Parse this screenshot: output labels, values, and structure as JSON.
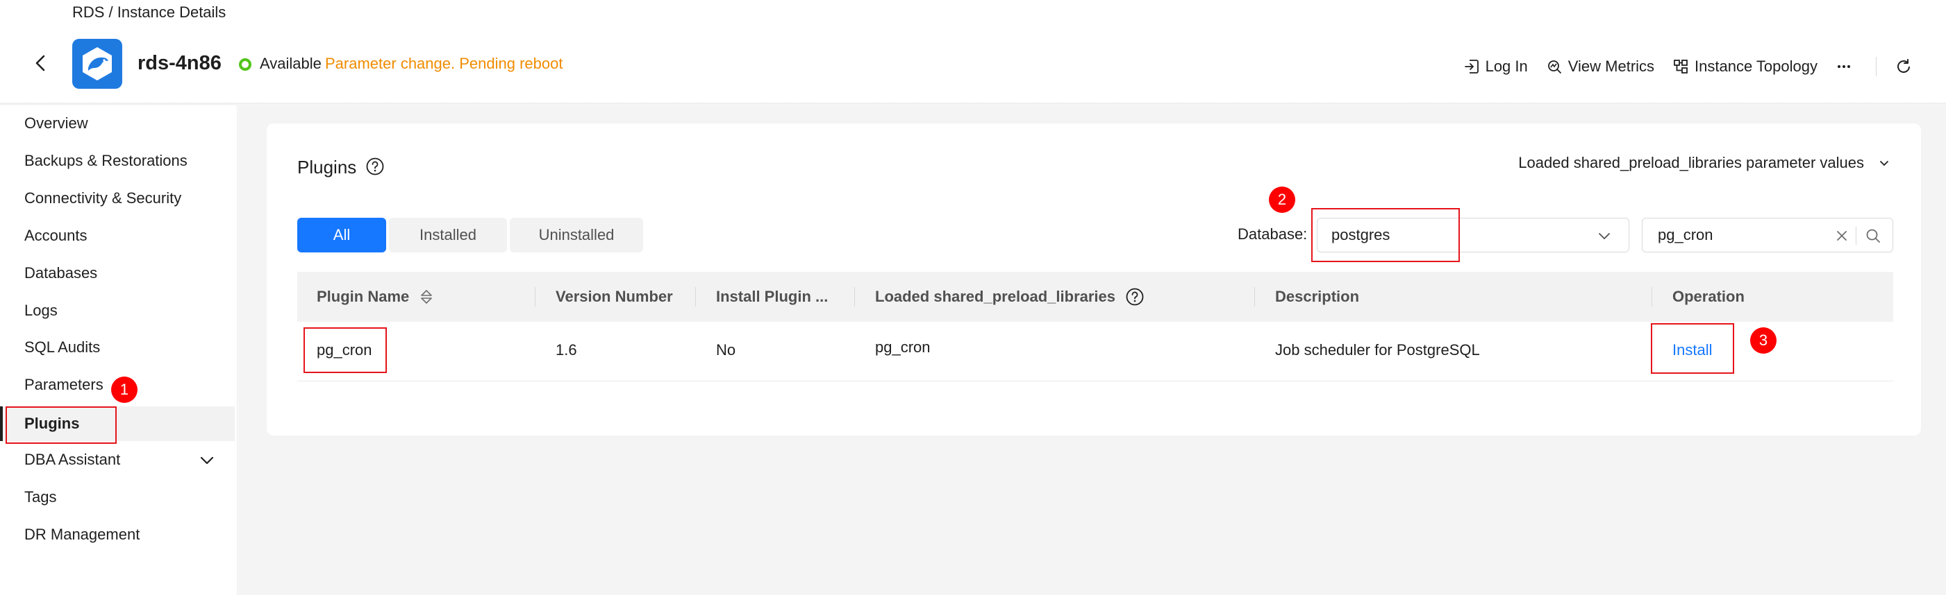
{
  "header": {
    "breadcrumb": "RDS / Instance Details",
    "instance_name": "rds-4n86",
    "status": "Available",
    "status_warning": "Parameter change. Pending reboot",
    "actions": {
      "login": "Log In",
      "metrics": "View Metrics",
      "topology": "Instance Topology"
    }
  },
  "sidebar": {
    "items": [
      {
        "label": "Overview"
      },
      {
        "label": "Backups & Restorations"
      },
      {
        "label": "Connectivity & Security"
      },
      {
        "label": "Accounts"
      },
      {
        "label": "Databases"
      },
      {
        "label": "Logs"
      },
      {
        "label": "SQL Audits"
      },
      {
        "label": "Parameters"
      },
      {
        "label": "Plugins"
      },
      {
        "label": "DBA Assistant"
      },
      {
        "label": "Tags"
      },
      {
        "label": "DR Management"
      }
    ],
    "active": "Plugins"
  },
  "plugins": {
    "title": "Plugins",
    "shared_dropdown": "Loaded shared_preload_libraries parameter values",
    "tabs": [
      "All",
      "Installed",
      "Uninstalled"
    ],
    "database_label": "Database:",
    "database_value": "postgres",
    "search_value": "pg_cron",
    "columns": [
      "Plugin Name",
      "Version Number",
      "Install Plugin ...",
      "Loaded shared_preload_libraries",
      "Description",
      "Operation"
    ],
    "rows": [
      {
        "name": "pg_cron",
        "version": "1.6",
        "install_plugin": "No",
        "loaded": "pg_cron",
        "description": "Job scheduler for PostgreSQL",
        "operation": "Install"
      }
    ]
  },
  "annotations": [
    "1",
    "2",
    "3"
  ],
  "colors": {
    "primary": "#1677ff",
    "status_ok": "#52c41a",
    "status_warning": "#f08c00",
    "annotation_red": "#e5141b"
  }
}
